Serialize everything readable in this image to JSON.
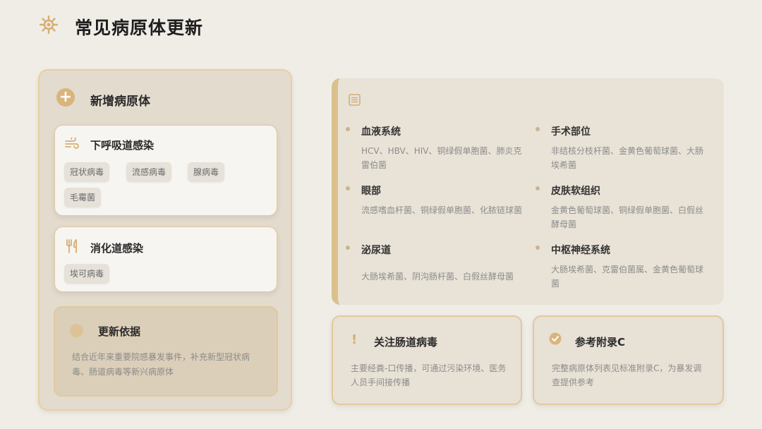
{
  "header": {
    "title": "常见病原体更新",
    "icon": "ship-wheel-icon"
  },
  "left": {
    "title": "新增病原体",
    "cards": [
      {
        "title": "下呼吸道感染",
        "chips": [
          "冠状病毒",
          "流感病毒",
          "腺病毒",
          "毛霉菌"
        ]
      },
      {
        "title": "消化道感染",
        "chips": [
          "埃可病毒"
        ]
      }
    ],
    "basis": {
      "title": "更新依据",
      "text": "结合近年来重要院感暴发事件，补充新型冠状病毒、肠道病毒等新兴病原体"
    }
  },
  "systems": [
    {
      "name": "血液系统",
      "text": "HCV、HBV、HIV、铜绿假单胞菌、肺炎克雷伯菌"
    },
    {
      "name": "手术部位",
      "text": "非结核分枝杆菌、金黄色葡萄球菌、大肠埃希菌"
    },
    {
      "name": "眼部",
      "text": "流感嗜血杆菌、铜绿假单胞菌、化脓链球菌"
    },
    {
      "name": "皮肤软组织",
      "text": "金黄色葡萄球菌、铜绿假单胞菌、白假丝酵母菌"
    },
    {
      "name": "泌尿道",
      "text": "大肠埃希菌、阴沟肠杆菌、白假丝酵母菌"
    },
    {
      "name": "中枢神经系统",
      "text": "大肠埃希菌、克雷伯菌属、金黄色葡萄球菌"
    }
  ],
  "boxes": [
    {
      "title": "关注肠道病毒",
      "text": "主要经粪-口传播，可通过污染环境、医务人员手间接传播"
    },
    {
      "title": "参考附录C",
      "text": "完整病原体列表见标准附录C，为暴发调查提供参考"
    }
  ],
  "colors": {
    "accent": "#d8b57d",
    "panel": "#e3dbcd",
    "card": "#f7f5f1"
  }
}
